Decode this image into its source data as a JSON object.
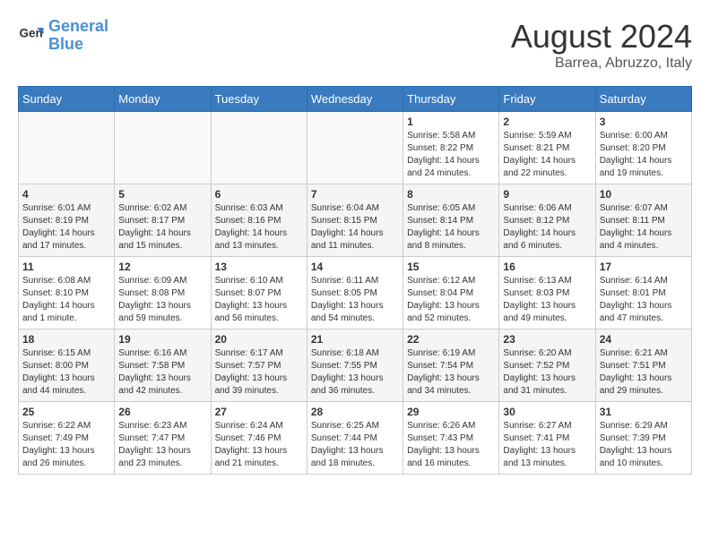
{
  "header": {
    "logo_line1": "General",
    "logo_line2": "Blue",
    "month": "August 2024",
    "location": "Barrea, Abruzzo, Italy"
  },
  "days_of_week": [
    "Sunday",
    "Monday",
    "Tuesday",
    "Wednesday",
    "Thursday",
    "Friday",
    "Saturday"
  ],
  "weeks": [
    [
      {
        "day": "",
        "info": ""
      },
      {
        "day": "",
        "info": ""
      },
      {
        "day": "",
        "info": ""
      },
      {
        "day": "",
        "info": ""
      },
      {
        "day": "1",
        "sunrise": "5:58 AM",
        "sunset": "8:22 PM",
        "daylight": "14 hours and 24 minutes."
      },
      {
        "day": "2",
        "sunrise": "5:59 AM",
        "sunset": "8:21 PM",
        "daylight": "14 hours and 22 minutes."
      },
      {
        "day": "3",
        "sunrise": "6:00 AM",
        "sunset": "8:20 PM",
        "daylight": "14 hours and 19 minutes."
      }
    ],
    [
      {
        "day": "4",
        "sunrise": "6:01 AM",
        "sunset": "8:19 PM",
        "daylight": "14 hours and 17 minutes."
      },
      {
        "day": "5",
        "sunrise": "6:02 AM",
        "sunset": "8:17 PM",
        "daylight": "14 hours and 15 minutes."
      },
      {
        "day": "6",
        "sunrise": "6:03 AM",
        "sunset": "8:16 PM",
        "daylight": "14 hours and 13 minutes."
      },
      {
        "day": "7",
        "sunrise": "6:04 AM",
        "sunset": "8:15 PM",
        "daylight": "14 hours and 11 minutes."
      },
      {
        "day": "8",
        "sunrise": "6:05 AM",
        "sunset": "8:14 PM",
        "daylight": "14 hours and 8 minutes."
      },
      {
        "day": "9",
        "sunrise": "6:06 AM",
        "sunset": "8:12 PM",
        "daylight": "14 hours and 6 minutes."
      },
      {
        "day": "10",
        "sunrise": "6:07 AM",
        "sunset": "8:11 PM",
        "daylight": "14 hours and 4 minutes."
      }
    ],
    [
      {
        "day": "11",
        "sunrise": "6:08 AM",
        "sunset": "8:10 PM",
        "daylight": "14 hours and 1 minute."
      },
      {
        "day": "12",
        "sunrise": "6:09 AM",
        "sunset": "8:08 PM",
        "daylight": "13 hours and 59 minutes."
      },
      {
        "day": "13",
        "sunrise": "6:10 AM",
        "sunset": "8:07 PM",
        "daylight": "13 hours and 56 minutes."
      },
      {
        "day": "14",
        "sunrise": "6:11 AM",
        "sunset": "8:05 PM",
        "daylight": "13 hours and 54 minutes."
      },
      {
        "day": "15",
        "sunrise": "6:12 AM",
        "sunset": "8:04 PM",
        "daylight": "13 hours and 52 minutes."
      },
      {
        "day": "16",
        "sunrise": "6:13 AM",
        "sunset": "8:03 PM",
        "daylight": "13 hours and 49 minutes."
      },
      {
        "day": "17",
        "sunrise": "6:14 AM",
        "sunset": "8:01 PM",
        "daylight": "13 hours and 47 minutes."
      }
    ],
    [
      {
        "day": "18",
        "sunrise": "6:15 AM",
        "sunset": "8:00 PM",
        "daylight": "13 hours and 44 minutes."
      },
      {
        "day": "19",
        "sunrise": "6:16 AM",
        "sunset": "7:58 PM",
        "daylight": "13 hours and 42 minutes."
      },
      {
        "day": "20",
        "sunrise": "6:17 AM",
        "sunset": "7:57 PM",
        "daylight": "13 hours and 39 minutes."
      },
      {
        "day": "21",
        "sunrise": "6:18 AM",
        "sunset": "7:55 PM",
        "daylight": "13 hours and 36 minutes."
      },
      {
        "day": "22",
        "sunrise": "6:19 AM",
        "sunset": "7:54 PM",
        "daylight": "13 hours and 34 minutes."
      },
      {
        "day": "23",
        "sunrise": "6:20 AM",
        "sunset": "7:52 PM",
        "daylight": "13 hours and 31 minutes."
      },
      {
        "day": "24",
        "sunrise": "6:21 AM",
        "sunset": "7:51 PM",
        "daylight": "13 hours and 29 minutes."
      }
    ],
    [
      {
        "day": "25",
        "sunrise": "6:22 AM",
        "sunset": "7:49 PM",
        "daylight": "13 hours and 26 minutes."
      },
      {
        "day": "26",
        "sunrise": "6:23 AM",
        "sunset": "7:47 PM",
        "daylight": "13 hours and 23 minutes."
      },
      {
        "day": "27",
        "sunrise": "6:24 AM",
        "sunset": "7:46 PM",
        "daylight": "13 hours and 21 minutes."
      },
      {
        "day": "28",
        "sunrise": "6:25 AM",
        "sunset": "7:44 PM",
        "daylight": "13 hours and 18 minutes."
      },
      {
        "day": "29",
        "sunrise": "6:26 AM",
        "sunset": "7:43 PM",
        "daylight": "13 hours and 16 minutes."
      },
      {
        "day": "30",
        "sunrise": "6:27 AM",
        "sunset": "7:41 PM",
        "daylight": "13 hours and 13 minutes."
      },
      {
        "day": "31",
        "sunrise": "6:29 AM",
        "sunset": "7:39 PM",
        "daylight": "13 hours and 10 minutes."
      }
    ]
  ]
}
